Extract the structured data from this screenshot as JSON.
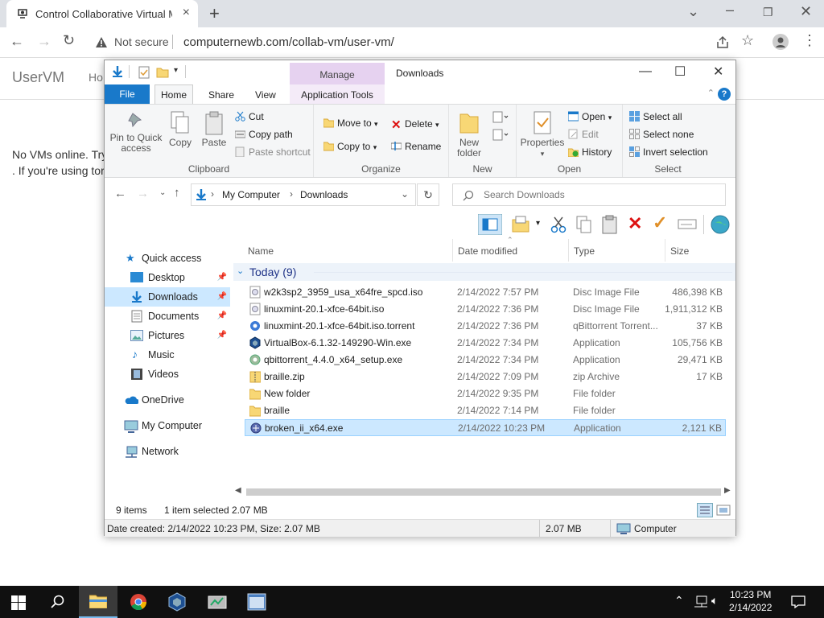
{
  "browser": {
    "tab_title": "Control Collaborative Virtual Ma",
    "security": "Not secure",
    "url": "computernewb.com/collab-vm/user-vm/"
  },
  "site": {
    "brand": "UserVM",
    "nav_home": "Ho",
    "message_line1": "No VMs online. Try",
    "message_line2": ". If you're using tor"
  },
  "explorer": {
    "title": "Downloads",
    "context_tab": "Manage",
    "tabs": {
      "file": "File",
      "home": "Home",
      "share": "Share",
      "view": "View",
      "app_tools": "Application Tools"
    },
    "help": "?",
    "ribbon": {
      "clipboard": {
        "label": "Clipboard",
        "pin": "Pin to Quick access",
        "copy": "Copy",
        "paste": "Paste",
        "cut": "Cut",
        "copy_path": "Copy path",
        "paste_shortcut": "Paste shortcut"
      },
      "organize": {
        "label": "Organize",
        "move_to": "Move to",
        "copy_to": "Copy to",
        "delete": "Delete",
        "rename": "Rename"
      },
      "new": {
        "label": "New",
        "new_folder": "New folder"
      },
      "open": {
        "label": "Open",
        "properties": "Properties",
        "open": "Open",
        "edit": "Edit",
        "history": "History"
      },
      "select": {
        "label": "Select",
        "select_all": "Select all",
        "select_none": "Select none",
        "invert": "Invert selection"
      }
    },
    "path": [
      "My Computer",
      "Downloads"
    ],
    "search_placeholder": "Search Downloads",
    "nav_pane": {
      "quick_access": "Quick access",
      "items": [
        "Desktop",
        "Downloads",
        "Documents",
        "Pictures",
        "Music",
        "Videos"
      ],
      "onedrive": "OneDrive",
      "my_computer": "My Computer",
      "network": "Network"
    },
    "columns": {
      "name": "Name",
      "date": "Date modified",
      "type": "Type",
      "size": "Size"
    },
    "group": "Today (9)",
    "files": [
      {
        "name": "w2k3sp2_3959_usa_x64fre_spcd.iso",
        "date": "2/14/2022 7:57 PM",
        "type": "Disc Image File",
        "size": "486,398 KB"
      },
      {
        "name": "linuxmint-20.1-xfce-64bit.iso",
        "date": "2/14/2022 7:36 PM",
        "type": "Disc Image File",
        "size": "1,911,312 KB"
      },
      {
        "name": "linuxmint-20.1-xfce-64bit.iso.torrent",
        "date": "2/14/2022 7:36 PM",
        "type": "qBittorrent Torrent...",
        "size": "37 KB"
      },
      {
        "name": "VirtualBox-6.1.32-149290-Win.exe",
        "date": "2/14/2022 7:34 PM",
        "type": "Application",
        "size": "105,756 KB"
      },
      {
        "name": "qbittorrent_4.4.0_x64_setup.exe",
        "date": "2/14/2022 7:34 PM",
        "type": "Application",
        "size": "29,471 KB"
      },
      {
        "name": "braille.zip",
        "date": "2/14/2022 7:09 PM",
        "type": "zip Archive",
        "size": "17 KB"
      },
      {
        "name": "New folder",
        "date": "2/14/2022 9:35 PM",
        "type": "File folder",
        "size": ""
      },
      {
        "name": "braille",
        "date": "2/14/2022 7:14 PM",
        "type": "File folder",
        "size": ""
      },
      {
        "name": "broken_ii_x64.exe",
        "date": "2/14/2022 10:23 PM",
        "type": "Application",
        "size": "2,121 KB"
      }
    ],
    "status": {
      "count": "9 items",
      "selected": "1 item selected",
      "size": "2.07 MB"
    },
    "details_bar": {
      "info": "Date created: 2/14/2022 10:23 PM, Size: 2.07 MB",
      "size": "2.07 MB",
      "location": "Computer"
    }
  },
  "taskbar": {
    "time": "10:23 PM",
    "date": "2/14/2022"
  }
}
